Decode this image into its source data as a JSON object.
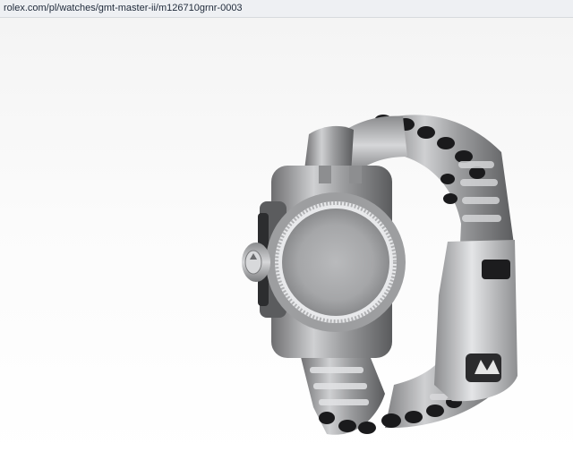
{
  "browser": {
    "url": "rolex.com/pl/watches/gmt-master-ii/m126710grnr-0003"
  },
  "product_view": {
    "image": "watch-caseback-view",
    "icons": [
      "crown-logo-icon",
      "winding-crown-icon"
    ]
  }
}
